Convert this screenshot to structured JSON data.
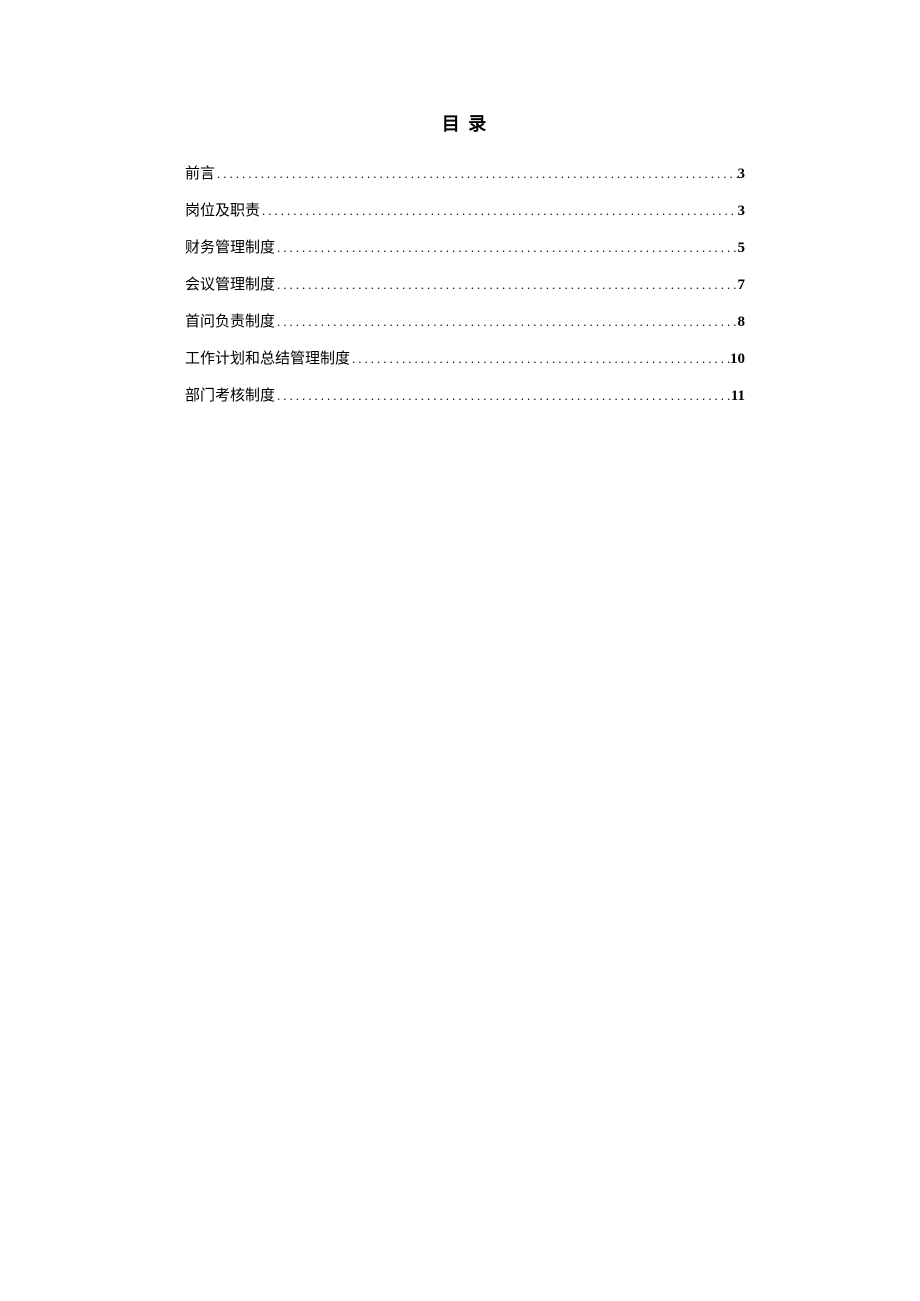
{
  "title": "目 录",
  "toc": [
    {
      "label": "前言",
      "page": "3"
    },
    {
      "label": "岗位及职责",
      "page": "3"
    },
    {
      "label": "财务管理制度",
      "page": "5"
    },
    {
      "label": "会议管理制度",
      "page": "7"
    },
    {
      "label": "首问负责制度",
      "page": "8"
    },
    {
      "label": "工作计划和总结管理制度",
      "page": "10"
    },
    {
      "label": "部门考核制度",
      "page": "11"
    }
  ]
}
